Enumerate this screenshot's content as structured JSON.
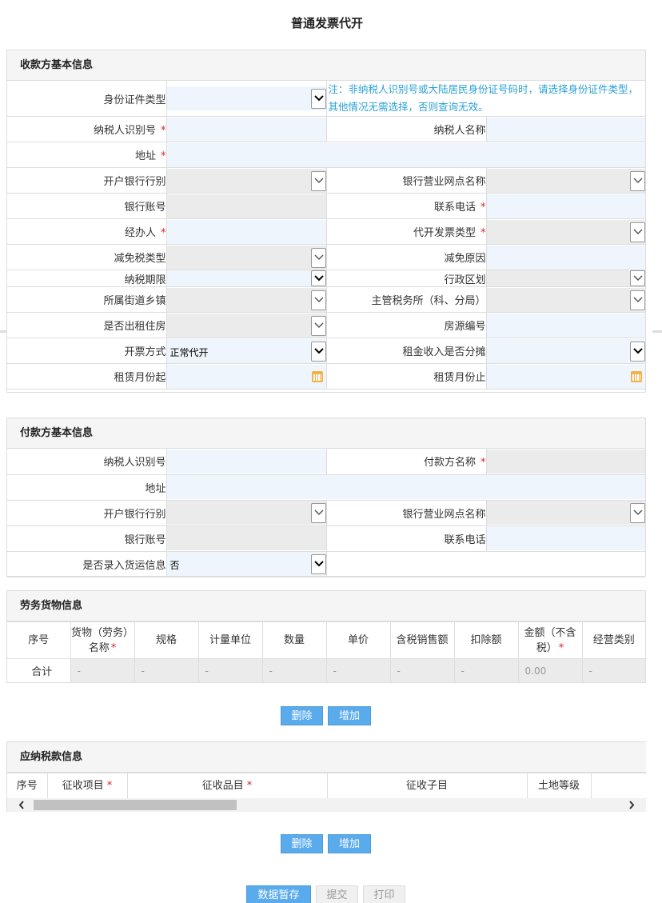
{
  "page_title": "普通发票代开",
  "payee": {
    "header": "收款方基本信息",
    "id_type_label": "身份证件类型",
    "note": "注：非纳税人识别号或大陆居民身份证号码时，请选择身份证件类型，其他情况无需选择，否则查询无效。",
    "taxpayer_id_label": "纳税人识别号",
    "taxpayer_name_label": "纳税人名称",
    "address_label": "地址",
    "bank_label": "开户银行行别",
    "bank_branch_label": "银行营业网点名称",
    "account_label": "银行账号",
    "phone_label": "联系电话",
    "handler_label": "经办人",
    "invoice_type_label": "代开发票类型",
    "exempt_type_label": "减免税类型",
    "exempt_reason_label": "减免原因",
    "tax_period_label": "纳税期限",
    "region_label": "行政区划",
    "street_label": "所属街道乡镇",
    "tax_office_label": "主管税务所（科、分局）",
    "rent_house_label": "是否出租住房",
    "house_no_label": "房源编号",
    "invoice_method_label": "开票方式",
    "invoice_method_value": "正常代开",
    "rent_split_label": "租金收入是否分摊",
    "rent_start_label": "租赁月份起",
    "rent_end_label": "租赁月份止",
    "required_mark": "*"
  },
  "payer": {
    "header": "付款方基本信息",
    "taxpayer_id_label": "纳税人识别号",
    "payer_name_label": "付款方名称",
    "address_label": "地址",
    "bank_label": "开户银行行别",
    "bank_branch_label": "银行营业网点名称",
    "account_label": "银行账号",
    "phone_label": "联系电话",
    "freight_label": "是否录入货运信息",
    "freight_value": "否"
  },
  "goods": {
    "header": "劳务货物信息",
    "columns": [
      "序号",
      "货物（劳务）名称",
      "规格",
      "计量单位",
      "数量",
      "单价",
      "含税销售额",
      "扣除额",
      "金额（不含税）",
      "经营类别"
    ],
    "sum_label": "合计",
    "sum_cells": [
      "-",
      "-",
      "-",
      "-",
      "-",
      "-",
      "-",
      "0.00",
      "-"
    ]
  },
  "goods_buttons": {
    "delete": "删除",
    "add": "增加"
  },
  "tax": {
    "header": "应纳税款信息",
    "columns": [
      "序号",
      "征收项目",
      "征收品目",
      "征收子目",
      "土地等级"
    ]
  },
  "tax_buttons": {
    "delete": "删除",
    "add": "增加"
  },
  "bottom_buttons": {
    "save": "数据暂存",
    "submit": "提交",
    "print": "打印"
  }
}
